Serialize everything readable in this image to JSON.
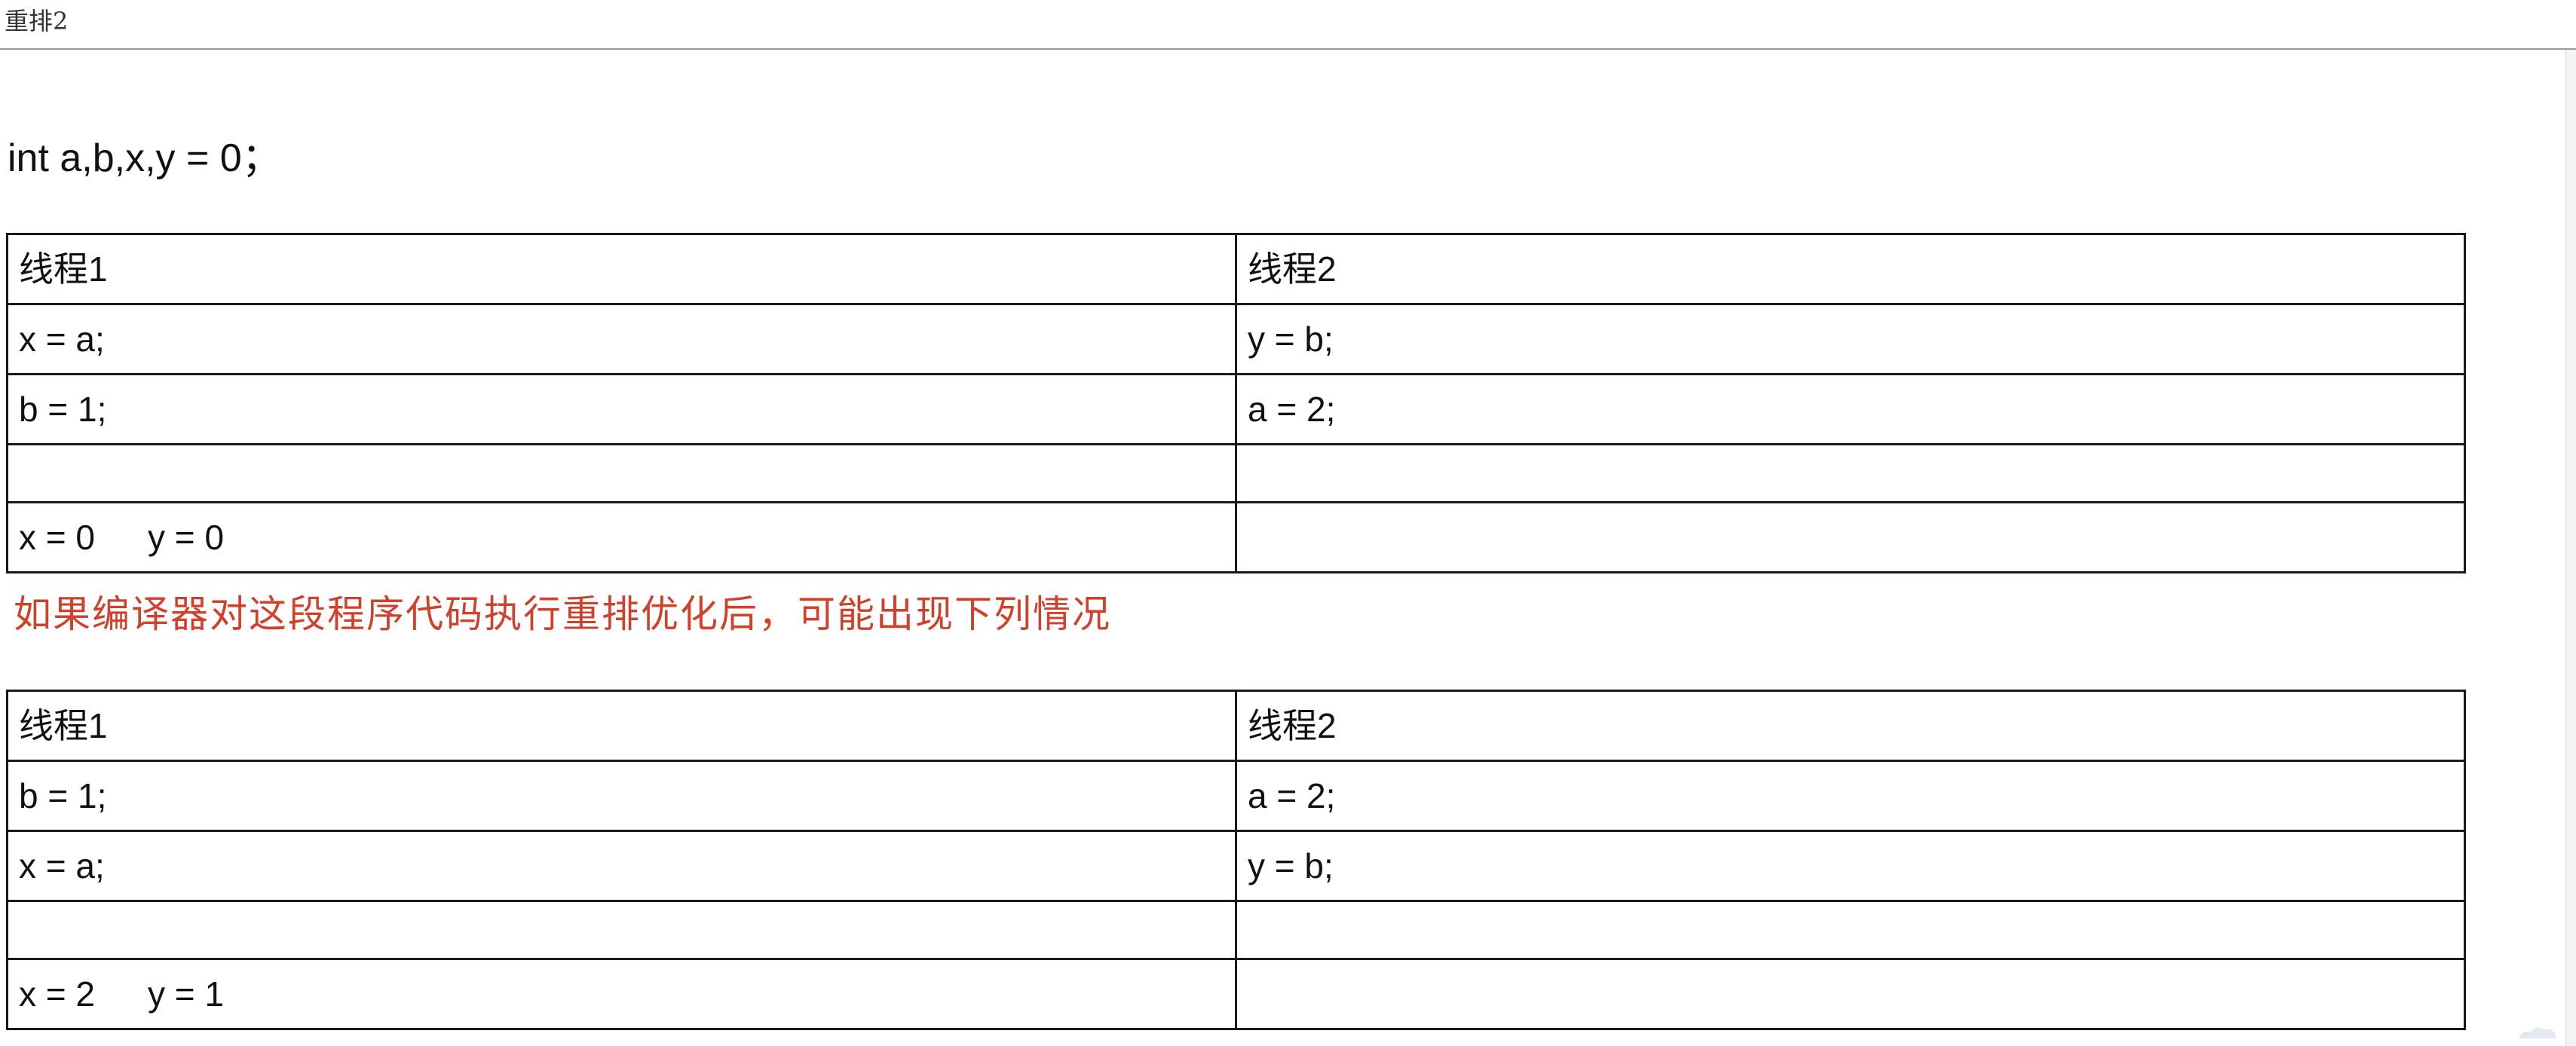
{
  "header": {
    "title": "重排2"
  },
  "declaration": "int a,b,x,y = 0；",
  "table1": {
    "headers": [
      "线程1",
      "线程2"
    ],
    "rows": [
      [
        "x = a;",
        "y = b;"
      ],
      [
        "b = 1;",
        "a = 2;"
      ],
      [
        "",
        ""
      ]
    ],
    "result": {
      "x": "x = 0",
      "y": "y = 0"
    }
  },
  "note": {
    "text": "如果编译器对这段程序代码执行重排优化后，可能出现下列情况",
    "color": "#d0402a"
  },
  "table2": {
    "headers": [
      "线程1",
      "线程2"
    ],
    "rows": [
      [
        "b = 1;",
        "a = 2;"
      ],
      [
        "x = a;",
        "y = b;"
      ],
      [
        "",
        ""
      ]
    ],
    "result": {
      "x": "x = 2",
      "y": "y = 1"
    }
  }
}
